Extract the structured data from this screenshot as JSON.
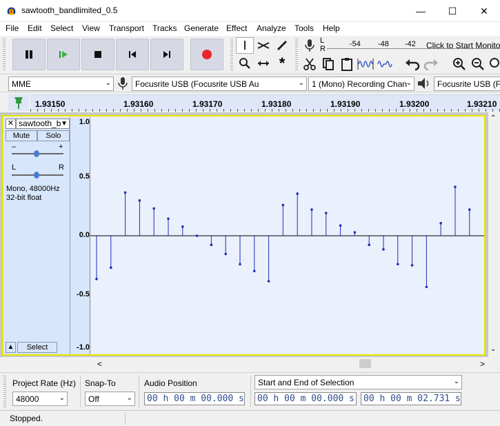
{
  "window": {
    "title": "sawtooth_bandlimited_0.5",
    "minimize_glyph": "—",
    "maximize_glyph": "☐",
    "close_glyph": "✕"
  },
  "menu": [
    "File",
    "Edit",
    "Select",
    "View",
    "Transport",
    "Tracks",
    "Generate",
    "Effect",
    "Analyze",
    "Tools",
    "Help"
  ],
  "meter": {
    "ticks": [
      "-54",
      "-48",
      "-42"
    ],
    "monitor_label": "Click to Start Monitoring",
    "L": "L",
    "R": "R"
  },
  "devices": {
    "host": "MME",
    "recording_device": "Focusrite USB (Focusrite USB Au",
    "channels": "1 (Mono) Recording Chan",
    "playback_device": "Focusrite USB (Fo"
  },
  "ruler": {
    "ticks": [
      "1.93150",
      "1.93160",
      "1.93170",
      "1.93180",
      "1.93190",
      "1.93200",
      "1.93210"
    ]
  },
  "track": {
    "name": "sawtooth_b",
    "close_glyph": "✕",
    "menu_glyph": "▼",
    "mute_label": "Mute",
    "solo_label": "Solo",
    "gain_minus": "–",
    "gain_plus": "+",
    "pan_left": "L",
    "pan_right": "R",
    "format_line1": "Mono, 48000Hz",
    "format_line2": "32-bit float",
    "collapse_glyph": "▲",
    "select_label": "Select",
    "vruler_labels": [
      "1.0",
      "0.5",
      "0.0",
      "-0.5",
      "-1.0"
    ]
  },
  "chart_data": {
    "type": "stem",
    "ylim": [
      -1.0,
      1.0
    ],
    "values": [
      -0.38,
      -0.28,
      0.38,
      0.31,
      0.24,
      0.15,
      0.08,
      0.0,
      -0.08,
      -0.16,
      -0.25,
      -0.31,
      -0.4,
      0.27,
      0.37,
      0.23,
      0.2,
      0.09,
      0.03,
      -0.08,
      -0.12,
      -0.25,
      -0.26,
      -0.45,
      0.11,
      0.43,
      0.23
    ]
  },
  "scroll": {
    "left": "<",
    "right": ">",
    "up": "^",
    "down": "v"
  },
  "selection_toolbar": {
    "project_rate_label": "Project Rate (Hz)",
    "project_rate_value": "48000",
    "snap_to_label": "Snap-To",
    "snap_to_value": "Off",
    "audio_position_label": "Audio Position",
    "audio_position_value": "00 h 00 m 00.000 s",
    "selection_mode": "Start and End of Selection",
    "selection_start": "00 h 00 m 00.000 s",
    "selection_end": "00 h 00 m 02.731 s"
  },
  "status": {
    "text": "Stopped."
  }
}
